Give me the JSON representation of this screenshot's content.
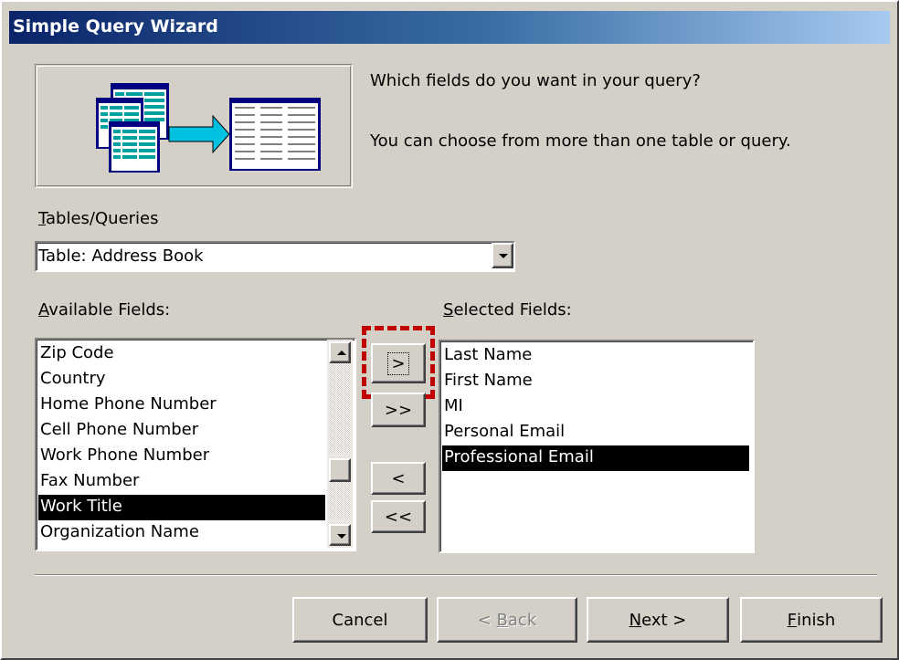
{
  "window": {
    "title": "Simple Query Wizard"
  },
  "intro": {
    "question": "Which fields do you want in your query?",
    "hint": "You can choose from more than one table or query."
  },
  "tables": {
    "label_ul": "T",
    "label_rest": "ables/Queries",
    "selected": "Table: Address Book"
  },
  "available": {
    "label_ul": "A",
    "label_rest": "vailable Fields:",
    "items": [
      "Zip Code",
      "Country",
      "Home Phone Number",
      "Cell Phone Number",
      "Work Phone Number",
      "Fax Number",
      "Work Title",
      "Organization Name"
    ],
    "selected_index": 6
  },
  "selected_fields": {
    "label_ul": "S",
    "label_rest": "elected Fields:",
    "items": [
      "Last Name",
      "First Name",
      "MI",
      "Personal Email",
      "Professional Email"
    ],
    "selected_index": 4
  },
  "move_buttons": {
    "add_one": ">",
    "add_all": ">>",
    "remove_one": "<",
    "remove_all": "<<"
  },
  "footer": {
    "cancel": "Cancel",
    "back_prefix": "< ",
    "back_ul": "B",
    "back_rest": "ack",
    "next_ul": "N",
    "next_rest": "ext >",
    "finish_ul": "F",
    "finish_rest": "inish"
  },
  "colors": {
    "titlebar_start": "#0a246a",
    "titlebar_end": "#a6caf0",
    "dialog_face": "#d4d0c8",
    "selection": "#000000",
    "annotation": "#c00000",
    "arrow": "#00c0e0"
  }
}
